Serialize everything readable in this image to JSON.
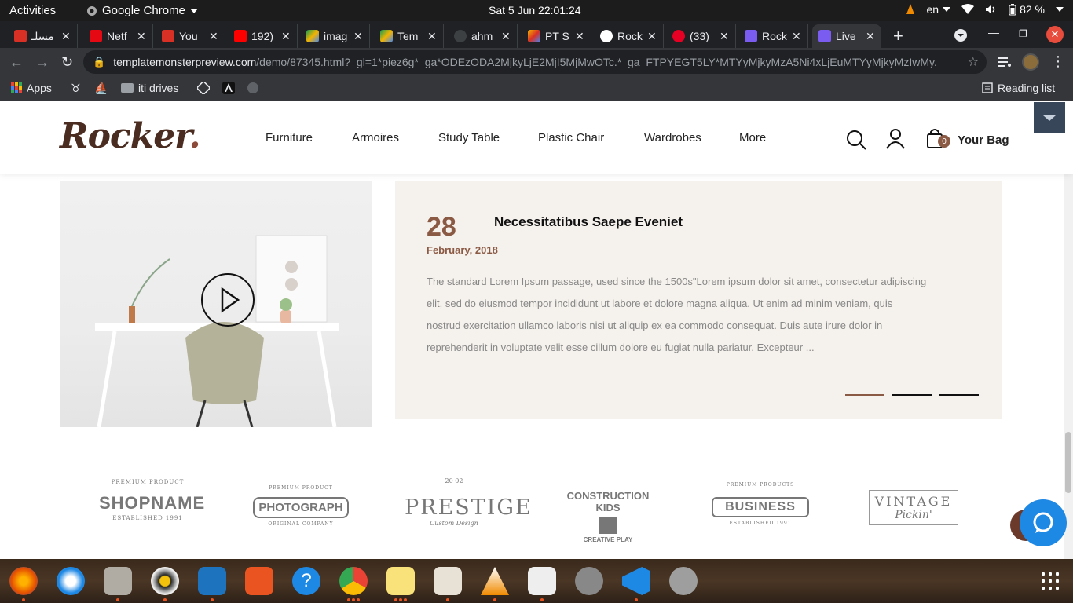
{
  "topbar": {
    "activities": "Activities",
    "app_name": "Google Chrome",
    "clock": "Sat 5 Jun  22:01:24",
    "language": "en",
    "battery": "82 %"
  },
  "tabs": [
    {
      "title": "مسلـ",
      "color": "#d93025"
    },
    {
      "title": "Netf",
      "color": "#e50914"
    },
    {
      "title": "You",
      "color": "#d93025"
    },
    {
      "title": "192)",
      "color": "#ff0000"
    },
    {
      "title": "imag",
      "color": "#1a73e8"
    },
    {
      "title": "Tem",
      "color": "#1a73e8"
    },
    {
      "title": "ahm",
      "color": "#3c4043"
    },
    {
      "title": "PT S",
      "color": "#f4b400"
    },
    {
      "title": "Rock",
      "color": "#ffffff"
    },
    {
      "title": "(33)",
      "color": "#e60023"
    },
    {
      "title": "Rock",
      "color": "#7b5cf0"
    },
    {
      "title": "Live",
      "color": "#7b5cf0"
    }
  ],
  "omnibox": {
    "domain": "templatemonsterpreview.com",
    "path": "/demo/87345.html?_gl=1*piez6g*_ga*ODEzODA2MjkyLjE2MjI5MjMwOTc.*_ga_FTPYEGT5LY*MTYyMjkyMzA5Ni4xLjEuMTYyMjkyMzIwMy..."
  },
  "bookmarks": {
    "apps": "Apps",
    "iti_drives": "iti drives",
    "reading_list": "Reading list"
  },
  "site": {
    "logo": "Rocker",
    "logo_dot": ".",
    "nav": [
      "Furniture",
      "Armoires",
      "Study Table",
      "Plastic Chair",
      "Wardrobes",
      "More"
    ],
    "bag_count": "0",
    "bag_label": "Your Bag"
  },
  "blog": {
    "day": "28",
    "month": "February, 2018",
    "title": "Necessitatibus Saepe Eveniet",
    "text": "The standard Lorem Ipsum passage, used since the 1500s\"Lorem ipsum dolor sit amet, consectetur adipiscing elit, sed do eiusmod tempor incididunt ut labore et dolore magna aliqua. Ut enim ad minim veniam, quis nostrud exercitation ullamco laboris nisi ut aliquip ex ea commodo consequat. Duis aute irure dolor in reprehenderit in voluptate velit esse cillum dolore eu fugiat nulla pariatur. Excepteur ..."
  },
  "brands": [
    {
      "top": "PREMIUM PRODUCT",
      "main": "SHOPNAME",
      "bottom": "ESTABLISHED 1991"
    },
    {
      "top": "PREMIUM PRODUCT",
      "main": "PHOTOGRAPH",
      "bottom": "ORIGINAL COMPANY"
    },
    {
      "top": "20    02",
      "main": "PRESTIGE",
      "bottom": "Custom Design"
    },
    {
      "top": "CONSTRUCTION KIDS",
      "main": "",
      "bottom": "CREATIVE PLAY"
    },
    {
      "top": "PREMIUM PRODUCTS",
      "main": "BUSINESS",
      "bottom": "ESTABLISHED 1991"
    },
    {
      "top": "",
      "main": "VINTAGE",
      "bottom": "Pickin'"
    }
  ],
  "colors": {
    "accent": "#8b5a45",
    "card_bg": "#f5f1ec",
    "chat_blue": "#1e88e5"
  }
}
